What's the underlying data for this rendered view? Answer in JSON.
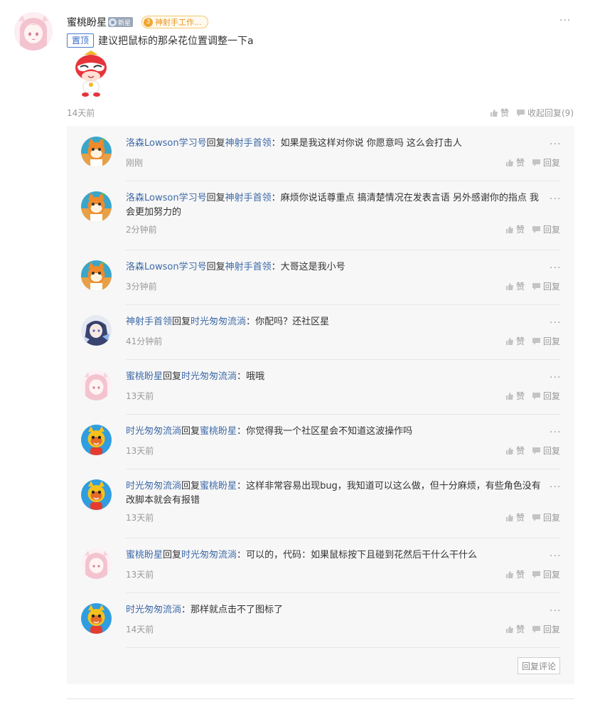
{
  "post": {
    "author": "蜜桃盼星",
    "new_badge": "新星",
    "level_number": "3",
    "level_title": "神射手工作...",
    "pinned_label": "置顶",
    "text": "建议把鼠标的那朵花位置调整一下a",
    "time": "14天前",
    "like_label": "赞",
    "collapse_label": "收起回复(9)",
    "more_icon": "···"
  },
  "replies": [
    {
      "from": "洛森Lowson学习号",
      "reply_word": "回复",
      "to": "神射手首领",
      "colon": "：",
      "text": "如果是我这样对你说 你愿意吗 这么会打击人",
      "time": "刚刚",
      "like": "赞",
      "reply": "回复",
      "avatar": "orange-cartoon"
    },
    {
      "from": "洛森Lowson学习号",
      "reply_word": "回复",
      "to": "神射手首领",
      "colon": "：",
      "text": "麻烦你说话尊重点 搞清楚情况在发表言语 另外感谢你的指点 我会更加努力的",
      "time": "2分钟前",
      "like": "赞",
      "reply": "回复",
      "avatar": "orange-cartoon"
    },
    {
      "from": "洛森Lowson学习号",
      "reply_word": "回复",
      "to": "神射手首领",
      "colon": "：",
      "text": "大哥这是我小号",
      "time": "3分钟前",
      "like": "赞",
      "reply": "回复",
      "avatar": "orange-cartoon"
    },
    {
      "from": "神射手首领",
      "reply_word": "回复",
      "to": "时光匆匆流淌",
      "colon": "：",
      "text": "你配吗？还社区星",
      "time": "41分钟前",
      "like": "赞",
      "reply": "回复",
      "avatar": "anime-dark"
    },
    {
      "from": "蜜桃盼星",
      "reply_word": "回复",
      "to": "时光匆匆流淌",
      "colon": "：",
      "text": "哦哦",
      "time": "13天前",
      "like": "赞",
      "reply": "回复",
      "avatar": "pink-anime"
    },
    {
      "from": "时光匆匆流淌",
      "reply_word": "回复",
      "to": "蜜桃盼星",
      "colon": "：",
      "text": "你觉得我一个社区星会不知道这波操作吗",
      "time": "13天前",
      "like": "赞",
      "reply": "回复",
      "avatar": "yellow-cat"
    },
    {
      "from": "时光匆匆流淌",
      "reply_word": "回复",
      "to": "蜜桃盼星",
      "colon": "：",
      "text": "这样非常容易出现bug，我知道可以这么做，但十分麻烦，有些角色没有改脚本就会有报错",
      "time": "13天前",
      "like": "赞",
      "reply": "回复",
      "avatar": "yellow-cat"
    },
    {
      "from": "蜜桃盼星",
      "reply_word": "回复",
      "to": "时光匆匆流淌",
      "colon": "：",
      "text": "可以的，代码：如果鼠标按下且碰到花然后干什么干什么",
      "time": "13天前",
      "like": "赞",
      "reply": "回复",
      "avatar": "pink-anime"
    },
    {
      "from": "时光匆匆流淌",
      "reply_word": "",
      "to": "",
      "colon": "：",
      "text": "那样就点击不了图标了",
      "time": "14天前",
      "like": "赞",
      "reply": "回复",
      "avatar": "yellow-cat"
    }
  ],
  "reply_comment_label": "回复评论",
  "colors": {
    "link": "#3e6aa8",
    "muted": "#999999",
    "panel": "#f7f7f7",
    "pinned": "#4a7bd0",
    "level": "#f0a630"
  }
}
